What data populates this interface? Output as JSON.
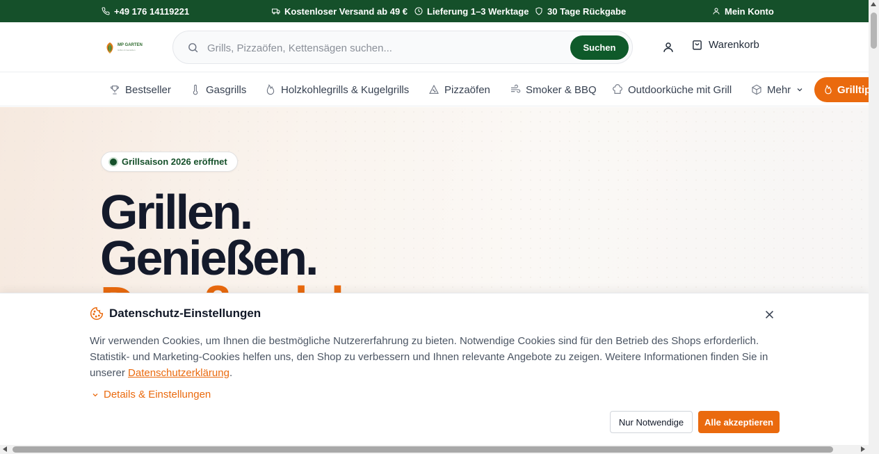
{
  "topbar": {
    "phone": "+49 176 14119221",
    "shipping": "Kostenloser Versand ab 49 €",
    "delivery": "Lieferung 1–3 Werktage",
    "returns": "30 Tage Rückgabe",
    "account": "Mein Konto",
    "bg_color": "#15502a"
  },
  "header": {
    "logo_name": "MP GARTEN",
    "logo_tagline": "Grillen & Genießen",
    "search_placeholder": "Grills, Pizzaöfen, Kettensägen suchen...",
    "search_button": "Suchen",
    "cart_label": "Warenkorb"
  },
  "nav": {
    "items": [
      {
        "label": "Bestseller",
        "icon": "trophy-icon"
      },
      {
        "label": "Gasgrills",
        "icon": "thermometer-icon"
      },
      {
        "label": "Holzkohlegrills & Kugelgrills",
        "icon": "flame-icon"
      },
      {
        "label": "Pizzaöfen",
        "icon": "pizza-icon"
      },
      {
        "label": "Smoker & BBQ",
        "icon": "wind-icon"
      },
      {
        "label": "Outdoorküche mit Grill",
        "icon": "chef-hat-icon"
      },
      {
        "label": "Mehr",
        "icon": "box-icon"
      }
    ],
    "promo_label": "Grilltipps",
    "accent_color": "#ea6a0e"
  },
  "hero": {
    "badge": "Grillsaison 2026 eröffnet",
    "headline_1": "Grillen.",
    "headline_2": "Genießen.",
    "headline_3": "Draußen leben."
  },
  "cookie": {
    "title": "Datenschutz-Einstellungen",
    "text_before_link": "Wir verwenden Cookies, um Ihnen die bestmögliche Nutzererfahrung zu bieten. Notwendige Cookies sind für den Betrieb des Shops erforderlich. Statistik- und Marketing-Cookies helfen uns, den Shop zu verbessern und Ihnen relevante Angebote zu zeigen. Weitere Informationen finden Sie in unserer ",
    "link_text": "Datenschutzerklärung",
    "text_after_link": ".",
    "details_label": "Details & Einstellungen",
    "btn_necessary": "Nur Notwendige",
    "btn_accept_all": "Alle akzeptieren"
  }
}
